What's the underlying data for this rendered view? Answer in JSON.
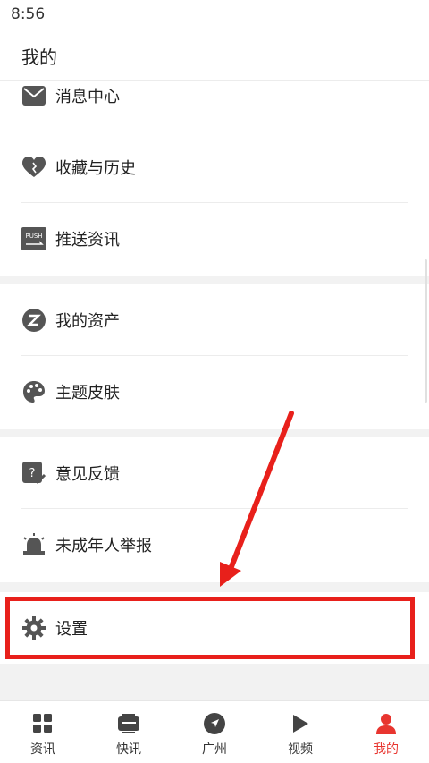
{
  "status_bar": {
    "time": "8:56"
  },
  "header": {
    "title": "我的"
  },
  "menu": {
    "messages": "消息中心",
    "favorites": "收藏与历史",
    "push": "推送资讯",
    "push_badge": "PUSH",
    "assets": "我的资产",
    "theme": "主题皮肤",
    "feedback": "意见反馈",
    "minor_report": "未成年人举报",
    "settings": "设置"
  },
  "tabs": [
    "资讯",
    "快讯",
    "广州",
    "视频",
    "我的"
  ],
  "colors": {
    "accent": "#e8352f",
    "highlight": "#e8201b",
    "icon": "#555555"
  }
}
